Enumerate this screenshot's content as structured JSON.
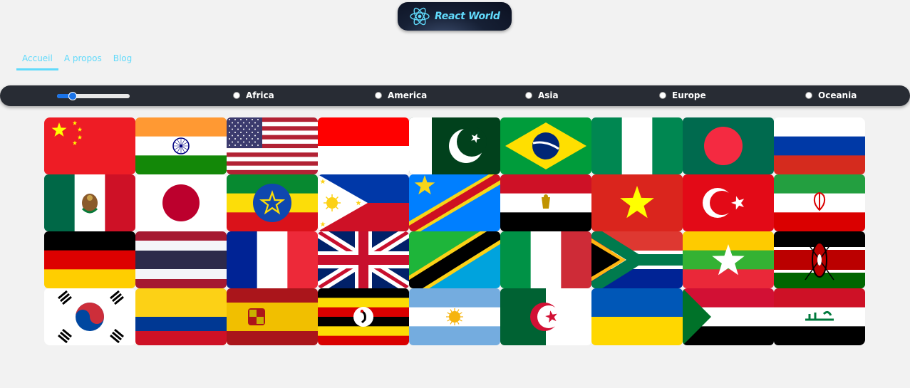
{
  "logo": {
    "text": "React World",
    "icon": "react-atom-icon"
  },
  "nav": [
    {
      "label": "Accueil",
      "active": true
    },
    {
      "label": "A propos",
      "active": false
    },
    {
      "label": "Blog",
      "active": false
    }
  ],
  "filter": {
    "slider_fraction": 0.18,
    "regions": [
      "Africa",
      "America",
      "Asia",
      "Europe",
      "Oceania"
    ]
  },
  "colors": {
    "accent": "#61dafb",
    "bar": "#282c34",
    "background": "#f2f2f2",
    "slider": "#1a73e8"
  },
  "flags": [
    "china-flag",
    "india-flag",
    "united-states-flag",
    "indonesia-flag",
    "pakistan-flag",
    "brazil-flag",
    "nigeria-flag",
    "bangladesh-flag",
    "russia-flag",
    "mexico-flag",
    "japan-flag",
    "ethiopia-flag",
    "philippines-flag",
    "dr-congo-flag",
    "egypt-flag",
    "vietnam-flag",
    "turkey-flag",
    "iran-flag",
    "germany-flag",
    "thailand-flag",
    "france-flag",
    "united-kingdom-flag",
    "tanzania-flag",
    "italy-flag",
    "south-africa-flag",
    "myanmar-flag",
    "kenya-flag",
    "south-korea-flag",
    "colombia-flag",
    "spain-flag",
    "uganda-flag",
    "argentina-flag",
    "algeria-flag",
    "ukraine-flag",
    "sudan-flag",
    "iraq-flag"
  ]
}
